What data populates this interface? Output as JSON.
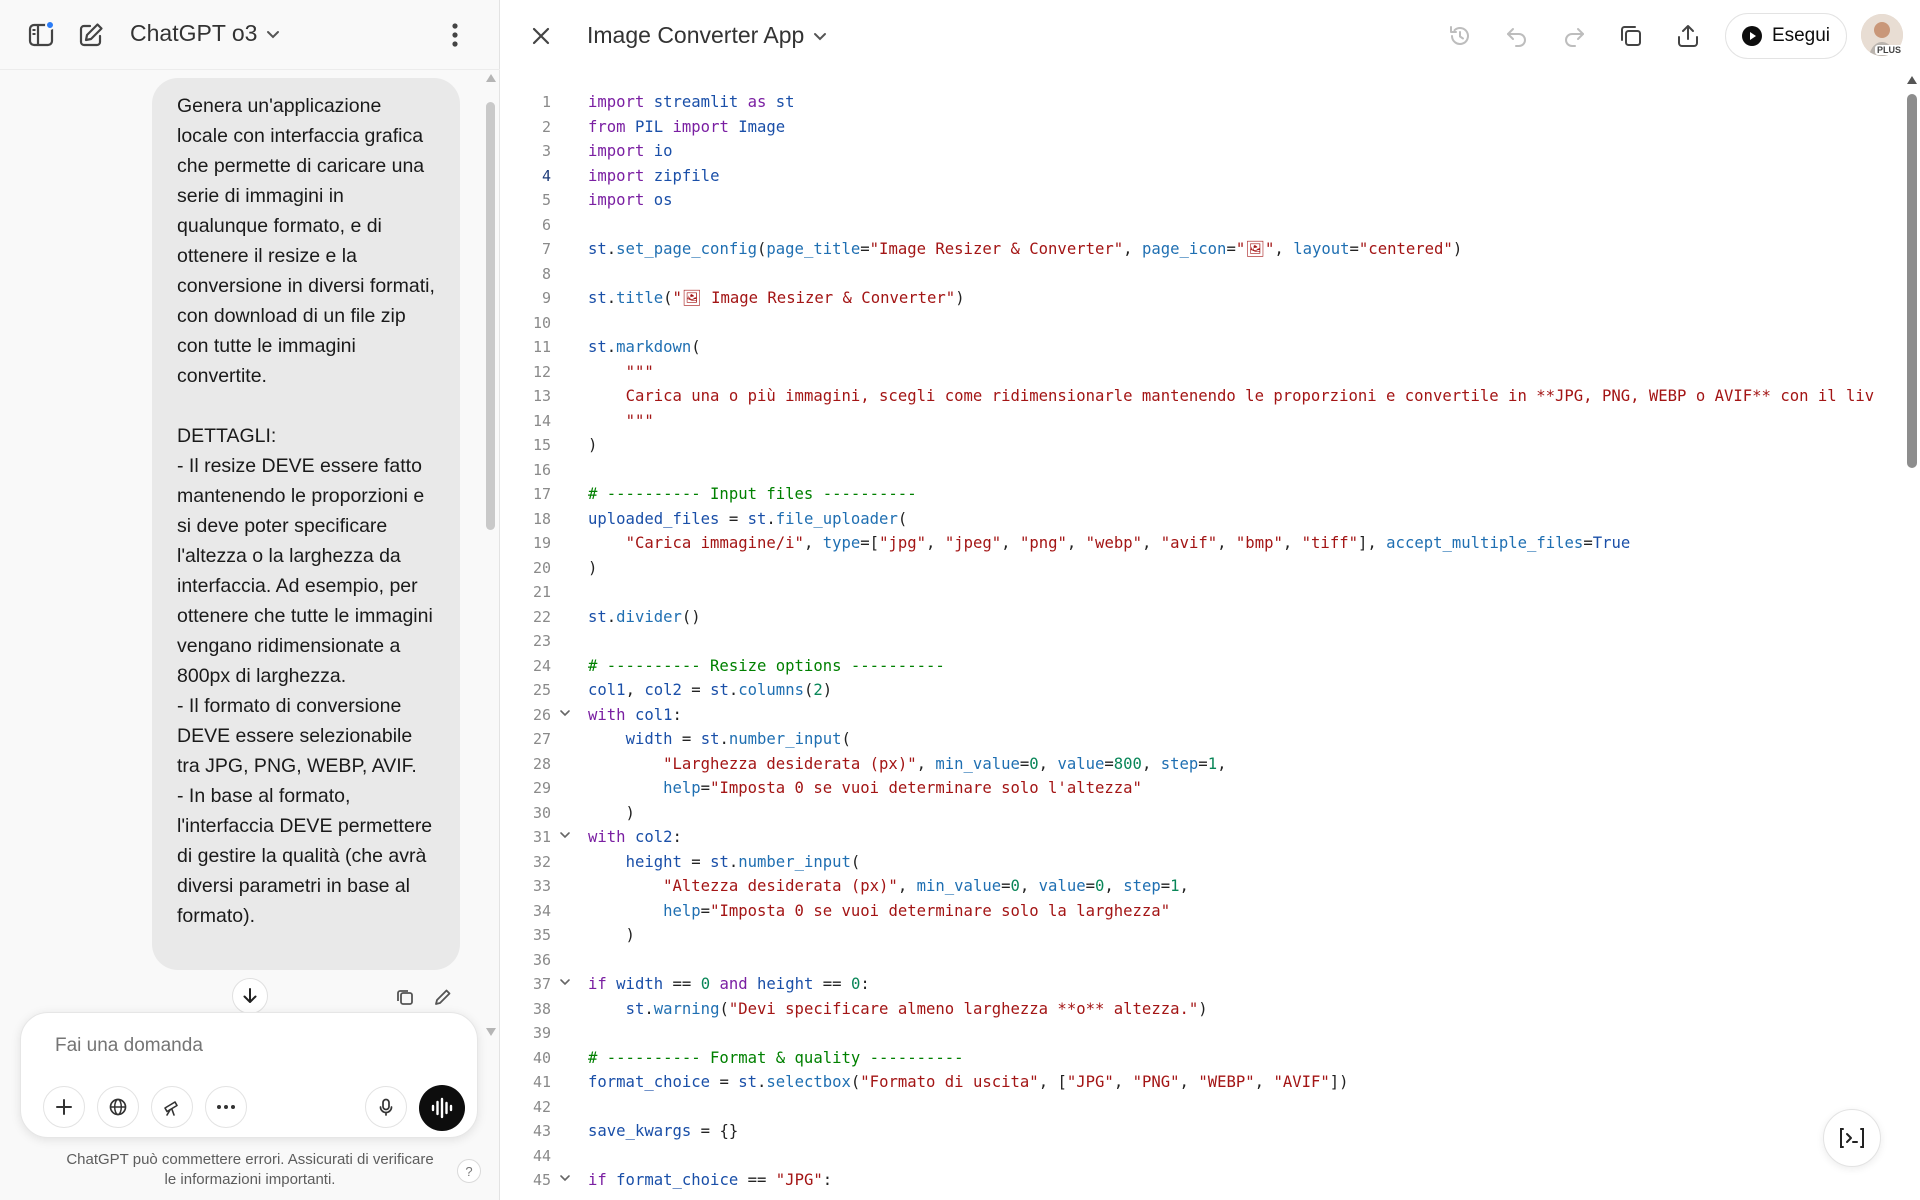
{
  "chat": {
    "model_label": "ChatGPT o3",
    "user_message": "Genera un'applicazione locale con interfaccia grafica che permette di caricare una serie di immagini in qualunque formato, e di ottenere il resize e la conversione in diversi formati, con download di un file zip con tutte le immagini convertite.\n\nDETTAGLI:\n- Il resize DEVE essere fatto mantenendo le proporzioni e si deve poter specificare l'altezza o la larghezza da interfaccia. Ad esempio, per ottenere che tutte le immagini vengano ridimensionate a 800px di larghezza.\n- Il formato di conversione DEVE essere selezionabile tra JPG, PNG, WEBP, AVIF.\n- In base al formato, l'interfaccia DEVE permettere di gestire la qualità (che avrà diversi parametri in base al formato).",
    "composer_placeholder": "Fai una domanda",
    "disclaimer": "ChatGPT può commettere errori. Assicurati di verificare le informazioni importanti.",
    "help_label": "?"
  },
  "canvas": {
    "title": "Image Converter App",
    "run_label": "Esegui",
    "plan_badge": "PLUS",
    "active_line": 4,
    "lines": [
      {
        "n": 1,
        "t": [
          [
            "k",
            "import"
          ],
          [
            "",
            " "
          ],
          [
            "v",
            "streamlit"
          ],
          [
            "",
            " "
          ],
          [
            "k",
            "as"
          ],
          [
            "",
            " "
          ],
          [
            "v",
            "st"
          ]
        ]
      },
      {
        "n": 2,
        "t": [
          [
            "k",
            "from"
          ],
          [
            "",
            " "
          ],
          [
            "v",
            "PIL"
          ],
          [
            "",
            " "
          ],
          [
            "k",
            "import"
          ],
          [
            "",
            " "
          ],
          [
            "v",
            "Image"
          ]
        ]
      },
      {
        "n": 3,
        "t": [
          [
            "k",
            "import"
          ],
          [
            "",
            " "
          ],
          [
            "v",
            "io"
          ]
        ]
      },
      {
        "n": 4,
        "t": [
          [
            "k",
            "import"
          ],
          [
            "",
            " "
          ],
          [
            "v",
            "zipfile"
          ]
        ]
      },
      {
        "n": 5,
        "t": [
          [
            "k",
            "import"
          ],
          [
            "",
            " "
          ],
          [
            "v",
            "os"
          ]
        ]
      },
      {
        "n": 6,
        "t": []
      },
      {
        "n": 7,
        "t": [
          [
            "v",
            "st"
          ],
          [
            "",
            "."
          ],
          [
            "f",
            "set_page_config"
          ],
          [
            "",
            "("
          ],
          [
            "p",
            "page_title"
          ],
          [
            "",
            "="
          ],
          [
            "s",
            "\"Image Resizer & Converter\""
          ],
          [
            "",
            ", "
          ],
          [
            "p",
            "page_icon"
          ],
          [
            "",
            "="
          ],
          [
            "s",
            "\"🖼\""
          ],
          [
            "",
            ", "
          ],
          [
            "p",
            "layout"
          ],
          [
            "",
            "="
          ],
          [
            "s",
            "\"centered\""
          ],
          [
            "",
            ")"
          ]
        ]
      },
      {
        "n": 8,
        "t": []
      },
      {
        "n": 9,
        "t": [
          [
            "v",
            "st"
          ],
          [
            "",
            "."
          ],
          [
            "f",
            "title"
          ],
          [
            "",
            "("
          ],
          [
            "s",
            "\"🖼 Image Resizer & Converter\""
          ],
          [
            "",
            ")"
          ]
        ]
      },
      {
        "n": 10,
        "t": []
      },
      {
        "n": 11,
        "t": [
          [
            "v",
            "st"
          ],
          [
            "",
            "."
          ],
          [
            "f",
            "markdown"
          ],
          [
            "",
            "("
          ]
        ]
      },
      {
        "n": 12,
        "t": [
          [
            "",
            "    "
          ],
          [
            "s",
            "\"\"\""
          ]
        ]
      },
      {
        "n": 13,
        "t": [
          [
            "",
            "    "
          ],
          [
            "s",
            "Carica una o più immagini, scegli come ridimensionarle mantenendo le proporzioni e convertile in **JPG, PNG, WEBP o AVIF** con il liv"
          ]
        ]
      },
      {
        "n": 14,
        "t": [
          [
            "",
            "    "
          ],
          [
            "s",
            "\"\"\""
          ]
        ]
      },
      {
        "n": 15,
        "t": [
          [
            "",
            ")"
          ]
        ]
      },
      {
        "n": 16,
        "t": []
      },
      {
        "n": 17,
        "t": [
          [
            "c",
            "# ---------- Input files ----------"
          ]
        ]
      },
      {
        "n": 18,
        "t": [
          [
            "v",
            "uploaded_files"
          ],
          [
            "",
            " = "
          ],
          [
            "v",
            "st"
          ],
          [
            "",
            "."
          ],
          [
            "f",
            "file_uploader"
          ],
          [
            "",
            "("
          ]
        ]
      },
      {
        "n": 19,
        "t": [
          [
            "",
            "    "
          ],
          [
            "s",
            "\"Carica immagine/i\""
          ],
          [
            "",
            ", "
          ],
          [
            "p",
            "type"
          ],
          [
            "",
            "=["
          ],
          [
            "s",
            "\"jpg\""
          ],
          [
            "",
            ", "
          ],
          [
            "s",
            "\"jpeg\""
          ],
          [
            "",
            ", "
          ],
          [
            "s",
            "\"png\""
          ],
          [
            "",
            ", "
          ],
          [
            "s",
            "\"webp\""
          ],
          [
            "",
            ", "
          ],
          [
            "s",
            "\"avif\""
          ],
          [
            "",
            ", "
          ],
          [
            "s",
            "\"bmp\""
          ],
          [
            "",
            ", "
          ],
          [
            "s",
            "\"tiff\""
          ],
          [
            "",
            "], "
          ],
          [
            "p",
            "accept_multiple_files"
          ],
          [
            "",
            "="
          ],
          [
            "v",
            "True"
          ]
        ]
      },
      {
        "n": 20,
        "t": [
          [
            "",
            ")"
          ]
        ]
      },
      {
        "n": 21,
        "t": []
      },
      {
        "n": 22,
        "t": [
          [
            "v",
            "st"
          ],
          [
            "",
            "."
          ],
          [
            "f",
            "divider"
          ],
          [
            "",
            "()"
          ]
        ]
      },
      {
        "n": 23,
        "t": []
      },
      {
        "n": 24,
        "t": [
          [
            "c",
            "# ---------- Resize options ----------"
          ]
        ]
      },
      {
        "n": 25,
        "t": [
          [
            "v",
            "col1"
          ],
          [
            "",
            ", "
          ],
          [
            "v",
            "col2"
          ],
          [
            "",
            " = "
          ],
          [
            "v",
            "st"
          ],
          [
            "",
            "."
          ],
          [
            "f",
            "columns"
          ],
          [
            "",
            "("
          ],
          [
            "n",
            "2"
          ],
          [
            "",
            ")"
          ]
        ]
      },
      {
        "n": 26,
        "fold": true,
        "t": [
          [
            "k",
            "with"
          ],
          [
            "",
            " "
          ],
          [
            "v",
            "col1"
          ],
          [
            "",
            ":"
          ]
        ]
      },
      {
        "n": 27,
        "t": [
          [
            "",
            "    "
          ],
          [
            "v",
            "width"
          ],
          [
            "",
            " = "
          ],
          [
            "v",
            "st"
          ],
          [
            "",
            "."
          ],
          [
            "f",
            "number_input"
          ],
          [
            "",
            "("
          ]
        ]
      },
      {
        "n": 28,
        "t": [
          [
            "",
            "        "
          ],
          [
            "s",
            "\"Larghezza desiderata (px)\""
          ],
          [
            "",
            ", "
          ],
          [
            "p",
            "min_value"
          ],
          [
            "",
            "="
          ],
          [
            "n",
            "0"
          ],
          [
            "",
            ", "
          ],
          [
            "p",
            "value"
          ],
          [
            "",
            "="
          ],
          [
            "n",
            "800"
          ],
          [
            "",
            ", "
          ],
          [
            "p",
            "step"
          ],
          [
            "",
            "="
          ],
          [
            "n",
            "1"
          ],
          [
            "",
            ","
          ]
        ]
      },
      {
        "n": 29,
        "t": [
          [
            "",
            "        "
          ],
          [
            "p",
            "help"
          ],
          [
            "",
            "="
          ],
          [
            "s",
            "\"Imposta 0 se vuoi determinare solo l'altezza\""
          ]
        ]
      },
      {
        "n": 30,
        "t": [
          [
            "",
            "    )"
          ]
        ]
      },
      {
        "n": 31,
        "fold": true,
        "t": [
          [
            "k",
            "with"
          ],
          [
            "",
            " "
          ],
          [
            "v",
            "col2"
          ],
          [
            "",
            ":"
          ]
        ]
      },
      {
        "n": 32,
        "t": [
          [
            "",
            "    "
          ],
          [
            "v",
            "height"
          ],
          [
            "",
            " = "
          ],
          [
            "v",
            "st"
          ],
          [
            "",
            "."
          ],
          [
            "f",
            "number_input"
          ],
          [
            "",
            "("
          ]
        ]
      },
      {
        "n": 33,
        "t": [
          [
            "",
            "        "
          ],
          [
            "s",
            "\"Altezza desiderata (px)\""
          ],
          [
            "",
            ", "
          ],
          [
            "p",
            "min_value"
          ],
          [
            "",
            "="
          ],
          [
            "n",
            "0"
          ],
          [
            "",
            ", "
          ],
          [
            "p",
            "value"
          ],
          [
            "",
            "="
          ],
          [
            "n",
            "0"
          ],
          [
            "",
            ", "
          ],
          [
            "p",
            "step"
          ],
          [
            "",
            "="
          ],
          [
            "n",
            "1"
          ],
          [
            "",
            ","
          ]
        ]
      },
      {
        "n": 34,
        "t": [
          [
            "",
            "        "
          ],
          [
            "p",
            "help"
          ],
          [
            "",
            "="
          ],
          [
            "s",
            "\"Imposta 0 se vuoi determinare solo la larghezza\""
          ]
        ]
      },
      {
        "n": 35,
        "t": [
          [
            "",
            "    )"
          ]
        ]
      },
      {
        "n": 36,
        "t": []
      },
      {
        "n": 37,
        "fold": true,
        "t": [
          [
            "k",
            "if"
          ],
          [
            "",
            " "
          ],
          [
            "v",
            "width"
          ],
          [
            "",
            " == "
          ],
          [
            "n",
            "0"
          ],
          [
            "",
            " "
          ],
          [
            "k",
            "and"
          ],
          [
            "",
            " "
          ],
          [
            "v",
            "height"
          ],
          [
            "",
            " == "
          ],
          [
            "n",
            "0"
          ],
          [
            "",
            ":"
          ]
        ]
      },
      {
        "n": 38,
        "t": [
          [
            "",
            "    "
          ],
          [
            "v",
            "st"
          ],
          [
            "",
            "."
          ],
          [
            "f",
            "warning"
          ],
          [
            "",
            "("
          ],
          [
            "s",
            "\"Devi specificare almeno larghezza **o** altezza.\""
          ],
          [
            "",
            ")"
          ]
        ]
      },
      {
        "n": 39,
        "t": []
      },
      {
        "n": 40,
        "t": [
          [
            "c",
            "# ---------- Format & quality ----------"
          ]
        ]
      },
      {
        "n": 41,
        "t": [
          [
            "v",
            "format_choice"
          ],
          [
            "",
            " = "
          ],
          [
            "v",
            "st"
          ],
          [
            "",
            "."
          ],
          [
            "f",
            "selectbox"
          ],
          [
            "",
            "("
          ],
          [
            "s",
            "\"Formato di uscita\""
          ],
          [
            "",
            ", ["
          ],
          [
            "s",
            "\"JPG\""
          ],
          [
            "",
            ", "
          ],
          [
            "s",
            "\"PNG\""
          ],
          [
            "",
            ", "
          ],
          [
            "s",
            "\"WEBP\""
          ],
          [
            "",
            ", "
          ],
          [
            "s",
            "\"AVIF\""
          ],
          [
            "",
            "])"
          ]
        ]
      },
      {
        "n": 42,
        "t": []
      },
      {
        "n": 43,
        "t": [
          [
            "v",
            "save_kwargs"
          ],
          [
            "",
            " = {}"
          ]
        ]
      },
      {
        "n": 44,
        "t": []
      },
      {
        "n": 45,
        "fold": true,
        "t": [
          [
            "k",
            "if"
          ],
          [
            "",
            " "
          ],
          [
            "v",
            "format_choice"
          ],
          [
            "",
            " == "
          ],
          [
            "s",
            "\"JPG\""
          ],
          [
            "",
            ":"
          ]
        ]
      }
    ]
  },
  "icons": {
    "sidebar_toggle": "sidebar-toggle-icon",
    "new_chat": "new-chat-icon",
    "more": "more-vertical-icon",
    "close": "close-icon",
    "history": "history-icon",
    "undo": "undo-icon",
    "redo": "redo-icon",
    "copy": "copy-icon",
    "share": "share-icon",
    "play": "play-icon",
    "console": "console-icon"
  },
  "colors": {
    "accent_dot": "#2b7cf6",
    "keyword": "#7a1fa2",
    "string": "#a31515",
    "number": "#098658",
    "comment": "#008000",
    "variable": "#1a4fa8"
  }
}
